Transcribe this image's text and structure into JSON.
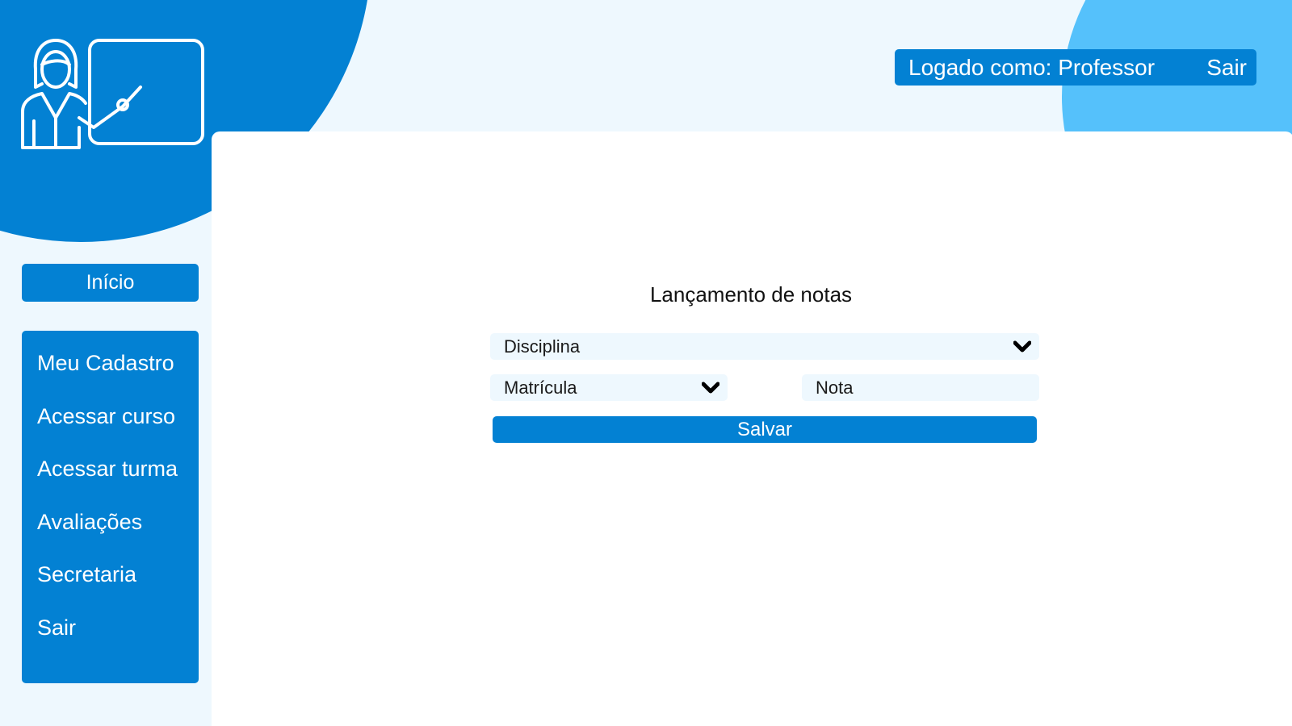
{
  "colors": {
    "primary": "#0381d3",
    "accent_light": "#55c1fb",
    "background": "#eef8fe",
    "panel": "#ffffff"
  },
  "logo": {
    "icon": "teacher-presentation-icon"
  },
  "header": {
    "logged_in_label": "Logado como: Professor",
    "logout_label": "Sair"
  },
  "sidebar": {
    "home_label": "Início",
    "items": [
      {
        "label": "Meu Cadastro"
      },
      {
        "label": "Acessar curso"
      },
      {
        "label": "Acessar turma"
      },
      {
        "label": "Avaliações"
      },
      {
        "label": "Secretaria"
      },
      {
        "label": "Sair"
      }
    ]
  },
  "form": {
    "title": "Lançamento de notas",
    "disciplina_select": {
      "value": "Disciplina",
      "icon": "chevron-down-icon"
    },
    "matricula_select": {
      "value": "Matrícula",
      "icon": "chevron-down-icon"
    },
    "nota_input": {
      "placeholder": "Nota"
    },
    "save_label": "Salvar"
  }
}
